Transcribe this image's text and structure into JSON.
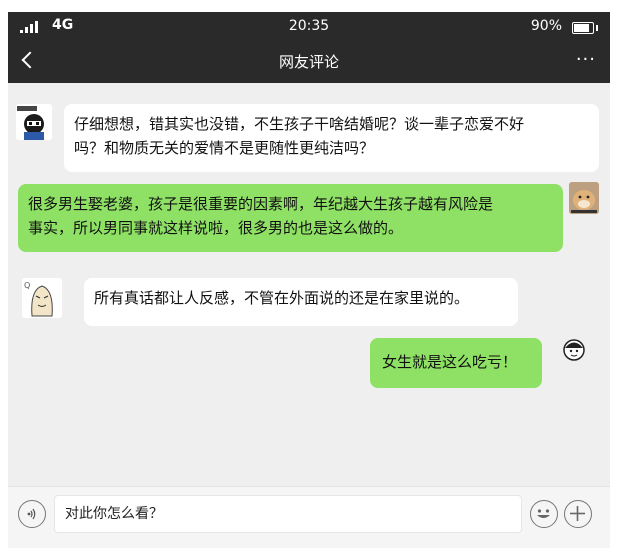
{
  "status_bar": {
    "network": "4G",
    "time": "20:35",
    "battery": "90%"
  },
  "nav": {
    "title": "网友评论",
    "more": "···"
  },
  "messages": [
    {
      "side": "left",
      "bubble_color": "#ffffff",
      "text_line1": "仔细想想，错其实也没错，不生孩子干啥结婚呢？谈一辈子恋爱不好",
      "text_line2": "吗？和物质无关的爱情不是更随性更纯洁吗？",
      "avatar_icon": "anime-character-icon"
    },
    {
      "side": "right",
      "bubble_color": "#8ee164",
      "text_line1": "很多男生娶老婆，孩子是很重要的因素啊，年纪越大生孩子越有风险是",
      "text_line2": "事实，所以男同事就这样说啦，很多男的也是这么做的。",
      "avatar_icon": "dog-icon"
    },
    {
      "side": "left",
      "bubble_color": "#ffffff",
      "text_line1": "所有真话都让人反感，不管在外面说的还是在家里说的。",
      "avatar_icon": "cartoon-face-icon"
    },
    {
      "side": "right",
      "bubble_color": "#8ee164",
      "text_line1": "女生就是这么吃亏！",
      "avatar_icon": "cartoon-face-icon"
    }
  ],
  "input_bar": {
    "value": "对此你怎么看？",
    "voice_icon": "voice-icon",
    "emoji_icon": "emoji-icon",
    "plus_icon": "plus-icon"
  },
  "colors": {
    "bar_bg": "#2a2a2a",
    "chat_bg": "#efefef",
    "green_bubble": "#8ee164"
  }
}
